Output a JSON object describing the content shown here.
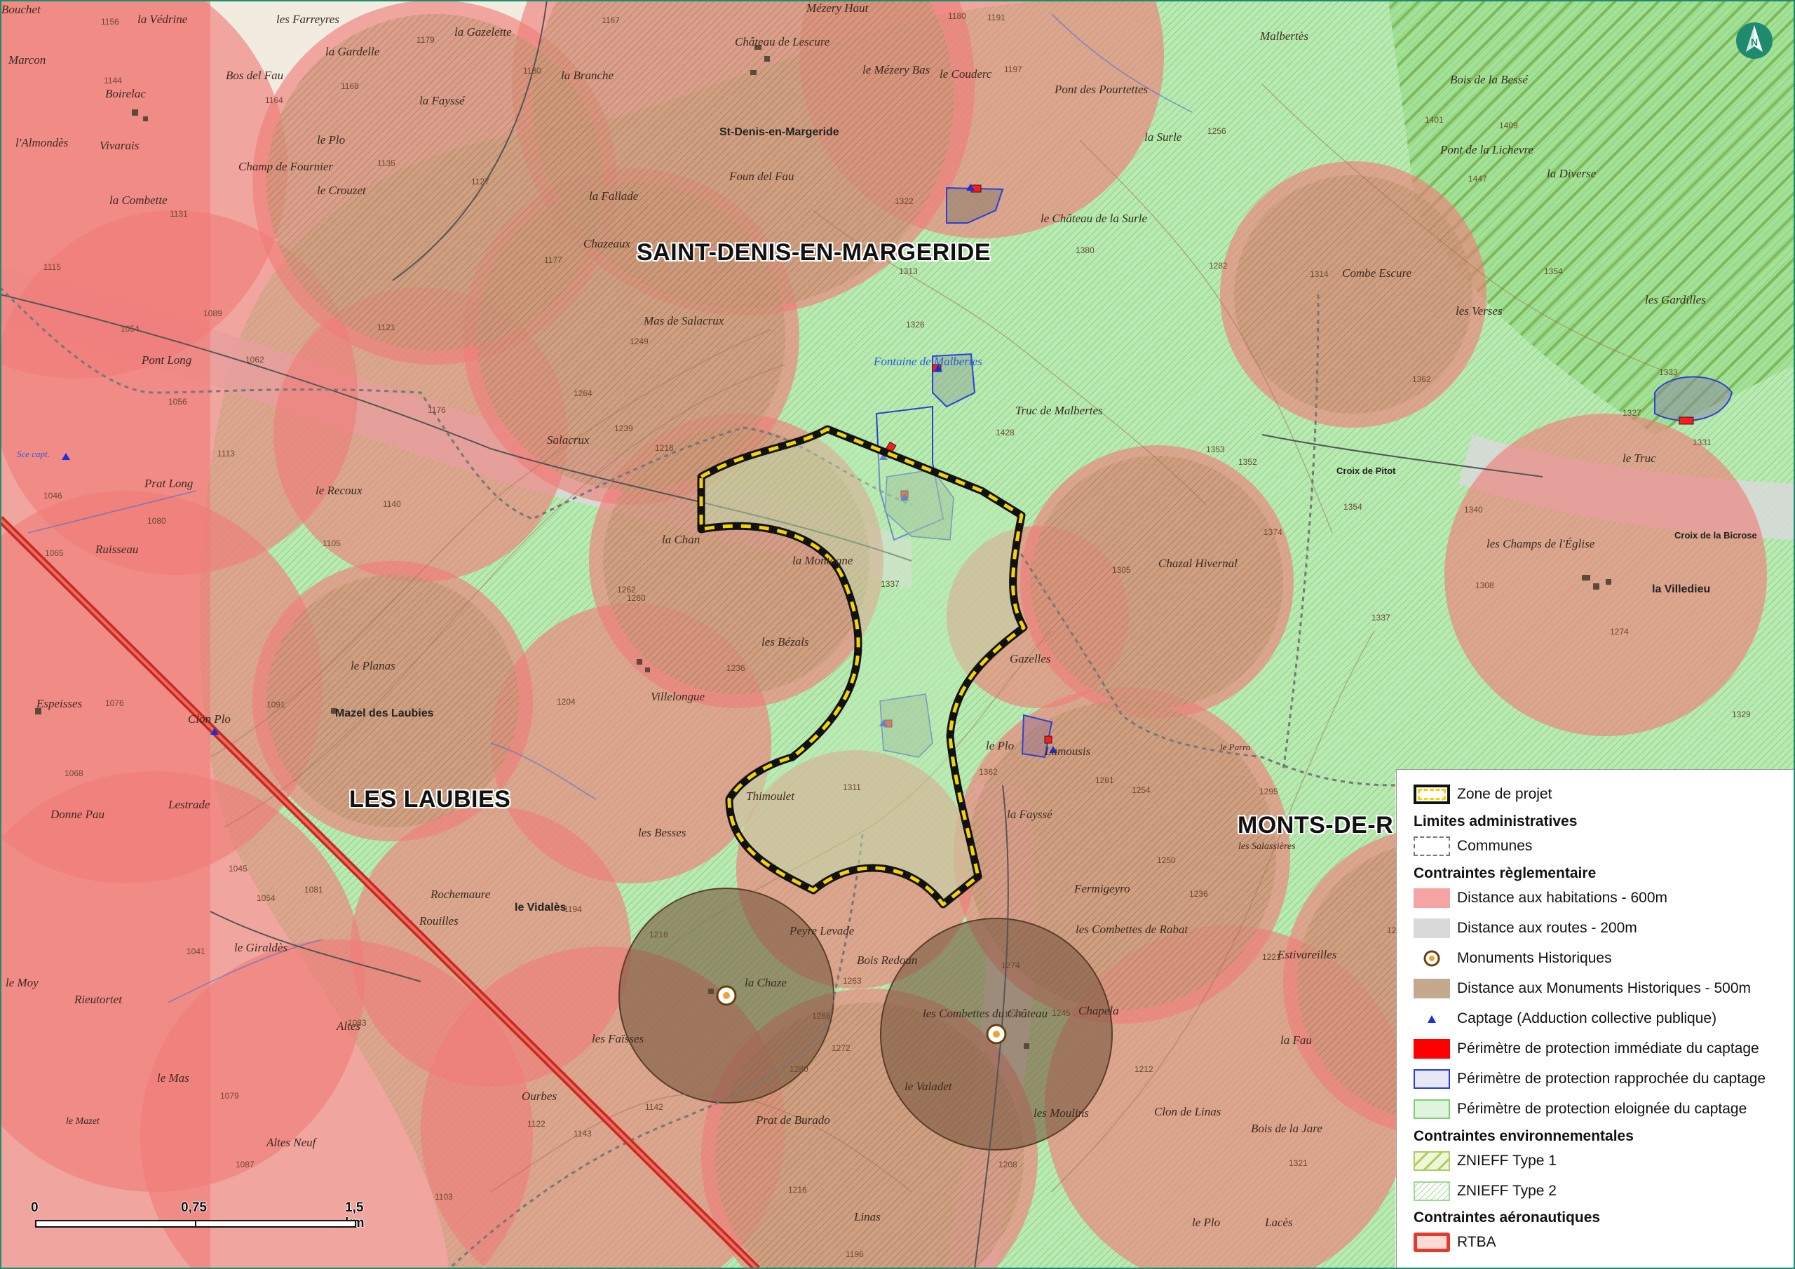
{
  "colors": {
    "habitation_buffer": "#f08a88",
    "road_buffer": "#d9d9d9",
    "monument_buffer": "#8a6a4e",
    "project_zone_border": "#f5d400",
    "eloignee": "#c6efc2",
    "rapprochee": "#1f3fe0",
    "immediate": "#ff0000",
    "znieff1": "#a9cf62",
    "znieff2": "#7ccf6f",
    "rtba": "#e33b2e",
    "captage": "#1a2fe0",
    "north_arrow": "#1e8a6e"
  },
  "north_arrow": {
    "icon": "north-arrow-icon",
    "label": "N"
  },
  "communes": [
    {
      "id": "saint-denis",
      "label": "SAINT-DENIS-EN-MARGERIDE"
    },
    {
      "id": "les-laubies",
      "label": "LES LAUBIES"
    },
    {
      "id": "monts-de-r",
      "label": "MONTS-DE-R"
    }
  ],
  "places": [
    "Bouchet",
    "la Védrine",
    "les Farreyres",
    "la Gazelette",
    "Mézery Haut",
    "Malbertès",
    "Marcon",
    "la Gardelle",
    "Bos del Fau",
    "Boirelac",
    "la Fayssé",
    "la Branche",
    "Château de Lescure",
    "le Mézery Bas",
    "le Couderc",
    "Pont des Pourtettes",
    "Vivarais",
    "l'Almondès",
    "le Plo",
    "St-Denis-en-Margeride",
    "la Surle",
    "Bois de la Bessé",
    "Champ de Fournier",
    "le Crouzet",
    "Foun del Fau",
    "Pont de la Lichevre",
    "la Diverse",
    "la Combette",
    "la Fallade",
    "le Château de la Surle",
    "Chazeaux",
    "Combe Escure",
    "les Verses",
    "les Gardilles",
    "Mas de Salacrux",
    "Pont Long",
    "Fontaine de Malbertes",
    "Truc de Malbertes",
    "Salacrux",
    "le Recoux",
    "Prat Long",
    "Croix de Pitot",
    "le Truc",
    "la Chan",
    "la Montagne",
    "Chazal Hivernal",
    "les Champs de l'Église",
    "Croix de la Bicrose",
    "la Villedieu",
    "les Bézals",
    "Gazelles",
    "le Planas",
    "Villelongue",
    "Espeisses",
    "Clon Plo",
    "Mazel des Laubies",
    "le Plo",
    "Lamousis",
    "le Parro",
    "Thimoulet",
    "Donne Pau",
    "Lestrade",
    "la Fayssé",
    "les Besses",
    "les Salassières",
    "Rochemaure",
    "le Vidalès",
    "Fermigeyro",
    "Peyre Levade",
    "les Combettes de Rabat",
    "Rouilles",
    "le Giraldès",
    "Bois Redoun",
    "Estivareilles",
    "le Moy",
    "la Chaze",
    "les Combettes du Château",
    "Chapela",
    "Altes",
    "les Faïsses",
    "le Valadet",
    "la Fau",
    "le Mas",
    "Ourbes",
    "Prat de Burado",
    "les Moulins",
    "Clon de Linas",
    "Bois de la Jare",
    "le Mazet",
    "Altes Neuf",
    "Linas",
    "le Plo",
    "Lacès",
    "Rieutortet",
    "Ruisseau",
    "Sce capt."
  ],
  "altitudes": [
    "1156",
    "1179",
    "1167",
    "1144",
    "1168",
    "1164",
    "1180",
    "1191",
    "1197",
    "1180",
    "1135",
    "1131",
    "1127",
    "1177",
    "1115",
    "1089",
    "1054",
    "1062",
    "1056",
    "1113",
    "1121",
    "1249",
    "1264",
    "1239",
    "1218",
    "1176",
    "1140",
    "1046",
    "1065",
    "1080",
    "1105",
    "1322",
    "1326",
    "1313",
    "1380",
    "1428",
    "1353",
    "1352",
    "1314",
    "1282",
    "1256",
    "1401",
    "1409",
    "1447",
    "1354",
    "1362",
    "1333",
    "1327",
    "1331",
    "1340",
    "1308",
    "1274",
    "1329",
    "1305",
    "1337",
    "1374",
    "1354",
    "1337",
    "1262",
    "1260",
    "1236",
    "1204",
    "1091",
    "1076",
    "1068",
    "1041",
    "1081",
    "1054",
    "1045",
    "1083",
    "1079",
    "1087",
    "1103",
    "1142",
    "1122",
    "1143",
    "1194",
    "1218",
    "1311",
    "1362",
    "1261",
    "1254",
    "1250",
    "1236",
    "1295",
    "1228",
    "1291",
    "1221",
    "1263",
    "1268",
    "1272",
    "1280",
    "1274",
    "1247",
    "1245",
    "1212",
    "1208",
    "1216",
    "1196",
    "1321"
  ],
  "scale_bar": {
    "ticks": [
      "0",
      "0,75",
      "1,5 km"
    ]
  },
  "legend": {
    "project_zone": "Zone de projet",
    "sections": [
      {
        "title": "Limites administratives",
        "items": [
          {
            "label": "Communes",
            "swatch": "communes"
          }
        ]
      },
      {
        "title": "Contraintes règlementaire",
        "items": [
          {
            "label": "Distance aux habitations - 600m",
            "swatch": "habitation"
          },
          {
            "label": "Distance aux routes - 200m",
            "swatch": "road"
          },
          {
            "label": "Monuments Historiques",
            "swatch": "monument-icon"
          },
          {
            "label": "Distance aux Monuments Historiques - 500m",
            "swatch": "monument"
          },
          {
            "label": "Captage (Adduction collective publique)",
            "swatch": "captage-icon"
          },
          {
            "label": "Périmètre de protection immédiate du captage",
            "swatch": "immediate"
          },
          {
            "label": "Périmètre de protection rapprochée du captage",
            "swatch": "rapprochee"
          },
          {
            "label": "Périmètre de protection eloignée du captage",
            "swatch": "eloignee"
          }
        ]
      },
      {
        "title": "Contraintes environnementales",
        "items": [
          {
            "label": "ZNIEFF Type 1",
            "swatch": "znieff1"
          },
          {
            "label": "ZNIEFF Type 2",
            "swatch": "znieff2"
          }
        ]
      },
      {
        "title": "Contraintes aéronautiques",
        "items": [
          {
            "label": "RTBA",
            "swatch": "rtba"
          }
        ]
      }
    ]
  }
}
